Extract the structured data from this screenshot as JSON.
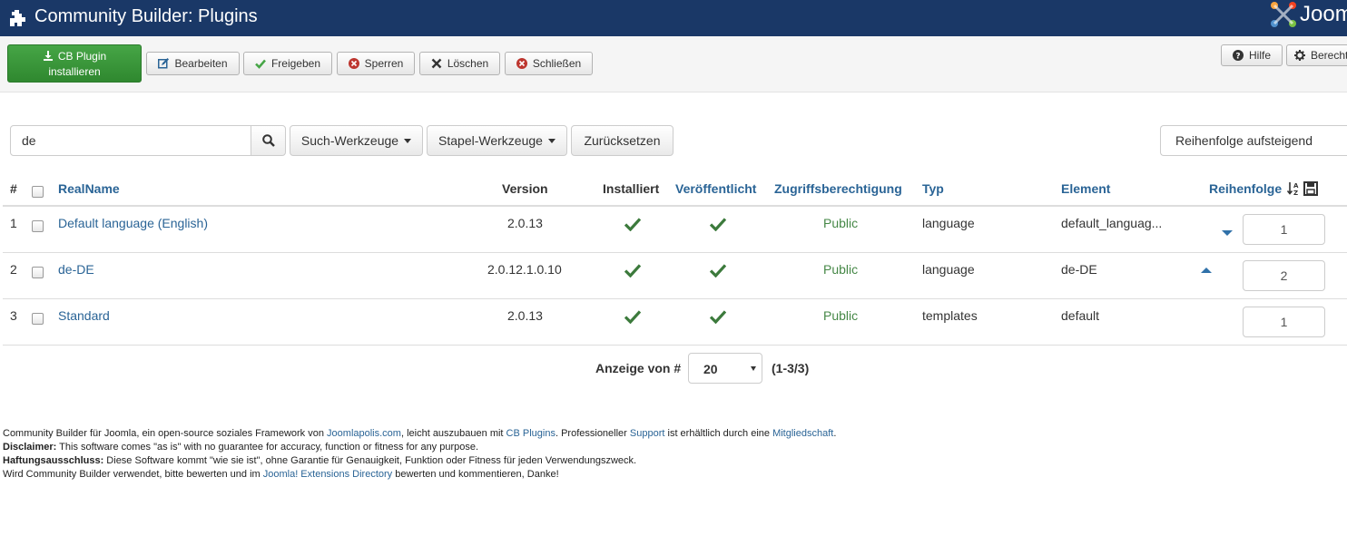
{
  "header": {
    "title": "Community Builder: Plugins",
    "icon": "puzzle-icon",
    "logo_text": "Joomla!"
  },
  "toolbar": {
    "install_line1": "CB Plugin",
    "install_line2": "installieren",
    "edit": "Bearbeiten",
    "publish": "Freigeben",
    "unpublish": "Sperren",
    "delete": "Löschen",
    "close": "Schließen",
    "help": "Hilfe",
    "options": "Berechtigungen"
  },
  "filters": {
    "search_value": "de",
    "search_tools": "Such-Werkzeuge",
    "batch_tools": "Stapel-Werkzeuge",
    "reset": "Zurücksetzen",
    "ordering_selected": "Reihenfolge aufsteigend"
  },
  "table": {
    "headers": {
      "num": "#",
      "realname": "RealName",
      "version": "Version",
      "installed": "Installiert",
      "published": "Veröffentlicht",
      "access": "Zugriffsberechtigung",
      "type": "Typ",
      "element": "Element",
      "ordering": "Reihenfolge"
    },
    "rows": [
      {
        "num": "1",
        "name": "Default language (English)",
        "version": "2.0.13",
        "access": "Public",
        "type": "language",
        "element": "default_languag...",
        "order": "1"
      },
      {
        "num": "2",
        "name": "de-DE",
        "version": "2.0.12.1.0.10",
        "access": "Public",
        "type": "language",
        "element": "de-DE",
        "order": "2"
      },
      {
        "num": "3",
        "name": "Standard",
        "version": "2.0.13",
        "access": "Public",
        "type": "templates",
        "element": "default",
        "order": "1"
      }
    ]
  },
  "pagination": {
    "label": "Anzeige von #",
    "limit": "20",
    "count": "(1-3/3)"
  },
  "footer": {
    "l1_a": "Community Builder für Joomla, ein open-source soziales Framework von ",
    "l1_link1": "Joomlapolis.com",
    "l1_b": ", leicht auszubauen mit ",
    "l1_link2": "CB Plugins",
    "l1_c": ". Professioneller ",
    "l1_link3": "Support",
    "l1_d": " ist erhältlich durch eine ",
    "l1_link4": "Mitgliedschaft",
    "l1_e": ".",
    "l2_bold": "Disclaimer:",
    "l2_text": " This software comes \"as is\" with no guarantee for accuracy, function or fitness for any purpose.",
    "l3_bold": "Haftungsausschluss:",
    "l3_text": " Diese Software kommt \"wie sie ist\", ohne Garantie für Genauigkeit, Funktion oder Fitness für jeden Verwendungszweck.",
    "l4_a": "Wird Community Builder verwendet, bitte bewerten und im ",
    "l4_link": "Joomla! Extensions Directory",
    "l4_b": " bewerten und kommentieren, Danke!"
  },
  "colors": {
    "header_bg": "#1a3867",
    "install_button": "#3c9a3c",
    "link": "#2a6496",
    "check": "#3c7a3c",
    "public": "#468847"
  }
}
